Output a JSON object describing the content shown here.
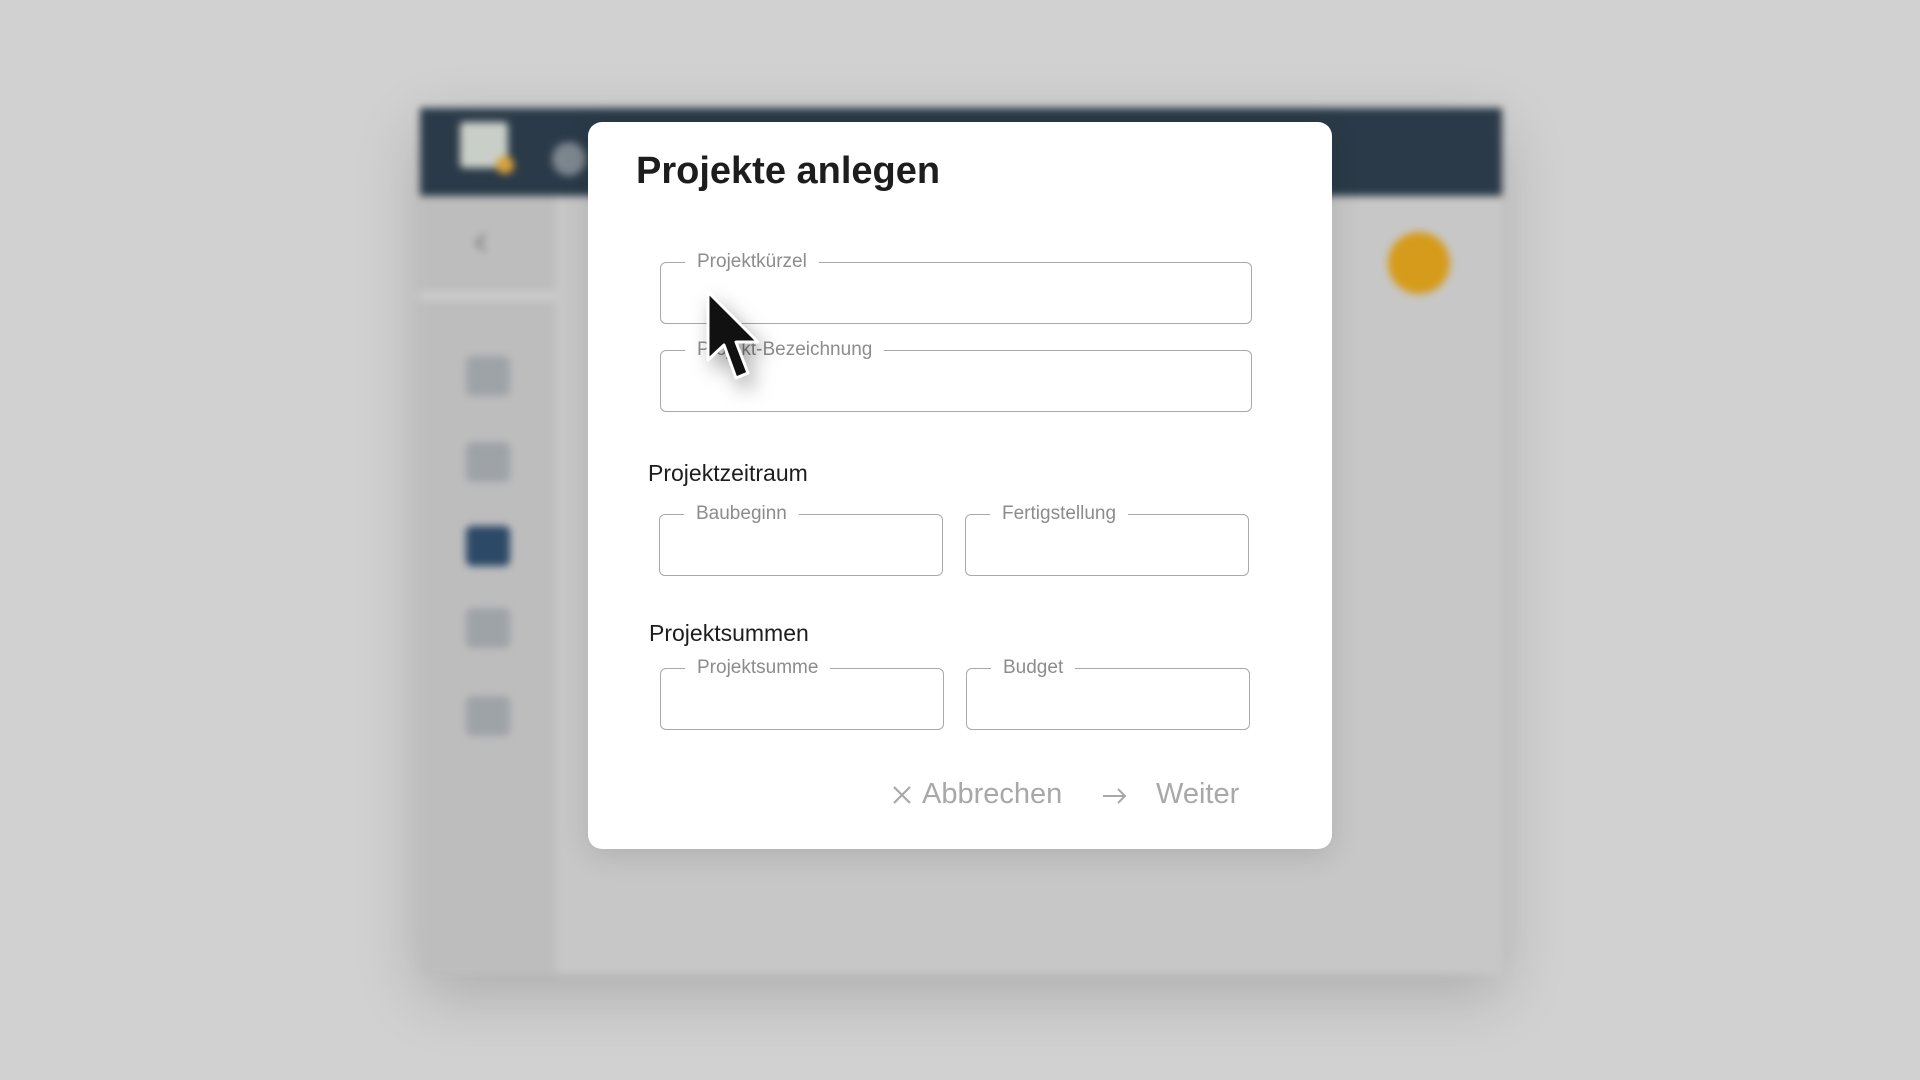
{
  "dialog": {
    "title": "Projekte anlegen",
    "fields": {
      "projektkuerzel": {
        "label": "Projektkürzel",
        "value": ""
      },
      "projektbezeichnung": {
        "label": "Projekt-Bezeichnung",
        "value": ""
      },
      "baubeginn": {
        "label": "Baubeginn",
        "value": ""
      },
      "fertigstellung": {
        "label": "Fertigstellung",
        "value": ""
      },
      "projektsumme": {
        "label": "Projektsumme",
        "value": ""
      },
      "budget": {
        "label": "Budget",
        "value": ""
      }
    },
    "sections": {
      "zeitraum": "Projektzeitraum",
      "summen": "Projektsummen"
    },
    "actions": {
      "cancel": "Abbrechen",
      "next": "Weiter"
    }
  },
  "icons": {
    "cancel": "close-icon",
    "next": "arrow-right-icon",
    "cursor": "mouse-pointer-icon"
  },
  "colors": {
    "topbar": "#2a3a48",
    "accent": "#d69b1a",
    "disabled_action": "#a8a8a8"
  }
}
